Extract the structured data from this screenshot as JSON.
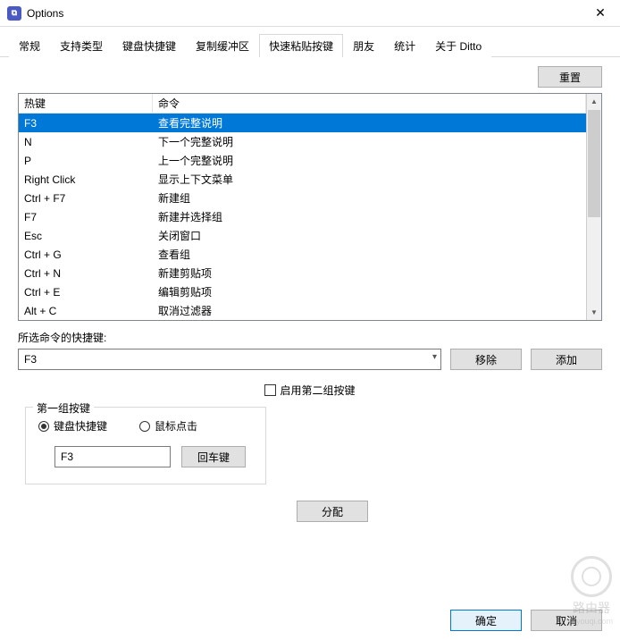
{
  "window": {
    "title": "Options"
  },
  "tabs": [
    {
      "label": "常规"
    },
    {
      "label": "支持类型"
    },
    {
      "label": "键盘快捷键"
    },
    {
      "label": "复制缓冲区"
    },
    {
      "label": "快速粘贴按键",
      "active": true
    },
    {
      "label": "朋友"
    },
    {
      "label": "统计"
    },
    {
      "label": "关于 Ditto"
    }
  ],
  "buttons": {
    "reset": "重置",
    "remove": "移除",
    "add": "添加",
    "enter": "回车键",
    "assign": "分配",
    "ok": "确定",
    "cancel": "取消"
  },
  "table": {
    "headers": {
      "hotkey": "热键",
      "command": "命令"
    },
    "rows": [
      {
        "hotkey": "F3",
        "command": "查看完整说明",
        "selected": true
      },
      {
        "hotkey": "N",
        "command": "下一个完整说明"
      },
      {
        "hotkey": "P",
        "command": "上一个完整说明"
      },
      {
        "hotkey": "Right Click",
        "command": "显示上下文菜单"
      },
      {
        "hotkey": "Ctrl + F7",
        "command": "新建组"
      },
      {
        "hotkey": "F7",
        "command": "新建并选择组"
      },
      {
        "hotkey": "Esc",
        "command": "关闭窗口"
      },
      {
        "hotkey": "Ctrl + G",
        "command": "查看组"
      },
      {
        "hotkey": "Ctrl + N",
        "command": "新建剪贴项"
      },
      {
        "hotkey": "Ctrl + E",
        "command": "编辑剪贴项"
      },
      {
        "hotkey": "Alt + C",
        "command": "取消过滤器"
      }
    ]
  },
  "selected_hotkey": {
    "label": "所选命令的快捷键:",
    "value": "F3"
  },
  "enable_second": {
    "label": "启用第二组按键",
    "checked": false
  },
  "group1": {
    "legend": "第一组按键",
    "radio_keyboard": "键盘快捷键",
    "radio_mouse": "鼠标点击",
    "selected": "keyboard",
    "input_value": "F3"
  },
  "watermark": {
    "line1": "路由器",
    "line2": "luyouqi.com"
  }
}
